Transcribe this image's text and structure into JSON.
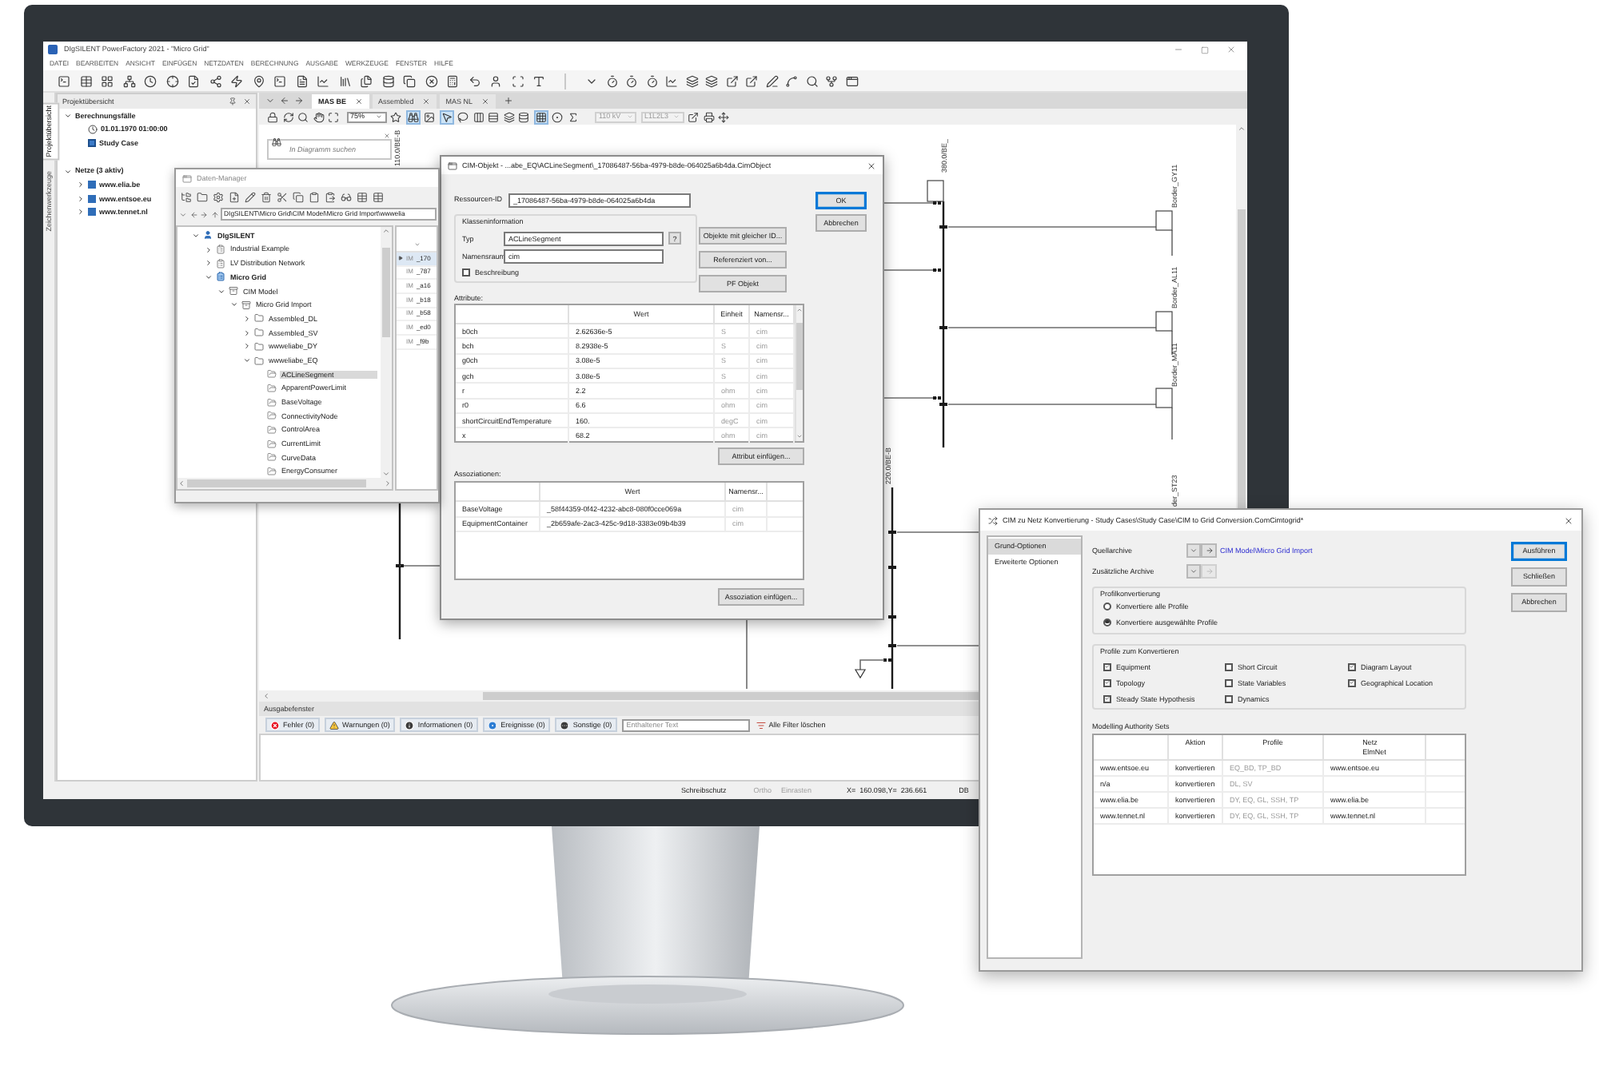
{
  "app": {
    "title": "DIgSILENT PowerFactory 2021 - \"Micro Grid\"",
    "menu": [
      "DATEI",
      "BEARBEITEN",
      "ANSICHT",
      "EINFÜGEN",
      "NETZDATEN",
      "BERECHNUNG",
      "AUSGABE",
      "WERKZEUGE",
      "FENSTER",
      "HILFE"
    ]
  },
  "side_tabs": [
    {
      "label": "Projektübersicht",
      "selected": true
    },
    {
      "label": "Zeichenwerkzeuge",
      "selected": false
    }
  ],
  "project_panel": {
    "title": "Projektübersicht",
    "tree": [
      {
        "label": "Berechnungsfälle",
        "kind": "group",
        "expanded": true,
        "children": [
          {
            "label": "01.01.1970 01:00:00",
            "kind": "time"
          },
          {
            "label": "Study Case",
            "kind": "case"
          }
        ]
      },
      {
        "label": "Netze (3 aktiv)",
        "kind": "group",
        "expanded": true,
        "children": [
          {
            "label": "www.elia.be",
            "kind": "grid",
            "expanded": false
          },
          {
            "label": "www.entsoe.eu",
            "kind": "grid",
            "expanded": false
          },
          {
            "label": "www.tennet.nl",
            "kind": "grid",
            "expanded": false
          }
        ]
      }
    ]
  },
  "diagram": {
    "tabs": [
      {
        "label": "MAS BE",
        "selected": true
      },
      {
        "label": "Assembled",
        "selected": false
      },
      {
        "label": "MAS NL",
        "selected": false
      }
    ],
    "zoom": "75%",
    "voltage": {
      "value": "110 kV",
      "disabled": true
    },
    "phases": {
      "value": "L1L2L3",
      "disabled": true
    },
    "search": {
      "placeholder": "In Diagramm suchen"
    },
    "labels": [
      "110.0/BE-B",
      "380.0/BE_",
      "Border_GY11",
      "Border_AL11",
      "Border_MA11",
      "220.0/BE-B",
      "der_ST23"
    ]
  },
  "data_manager": {
    "title": "Daten-Manager",
    "path": "DIgSILENT\\Micro Grid\\CIM Model\\Micro Grid Import\\wwwelia",
    "tree": [
      {
        "label": "DIgSILENT",
        "kind": "user",
        "expanded": true,
        "selected": false,
        "children": [
          {
            "label": "Industrial Example",
            "kind": "project",
            "expanded": false,
            "selected": false
          },
          {
            "label": "LV Distribution Network",
            "kind": "project",
            "expanded": false,
            "selected": false
          },
          {
            "label": "Micro Grid",
            "kind": "active_project",
            "expanded": true,
            "selected": false,
            "children": [
              {
                "label": "CIM Model",
                "kind": "archive",
                "expanded": true,
                "selected": false,
                "children": [
                  {
                    "label": "Micro Grid Import",
                    "kind": "archive",
                    "expanded": true,
                    "selected": false,
                    "children": [
                      {
                        "label": "Assembled_DL",
                        "kind": "folder",
                        "expanded": false,
                        "selected": false
                      },
                      {
                        "label": "Assembled_SV",
                        "kind": "folder",
                        "expanded": false,
                        "selected": false
                      },
                      {
                        "label": "wwweliabe_DY",
                        "kind": "folder",
                        "expanded": false,
                        "selected": false
                      },
                      {
                        "label": "wwweliabe_EQ",
                        "kind": "folder",
                        "expanded": true,
                        "selected": false,
                        "children": [
                          {
                            "label": "ACLineSegment",
                            "kind": "class",
                            "selected": true
                          },
                          {
                            "label": "ApparentPowerLimit",
                            "kind": "class",
                            "selected": false
                          },
                          {
                            "label": "BaseVoltage",
                            "kind": "class",
                            "selected": false
                          },
                          {
                            "label": "ConnectivityNode",
                            "kind": "class",
                            "selected": false
                          },
                          {
                            "label": "ControlArea",
                            "kind": "class",
                            "selected": false
                          },
                          {
                            "label": "CurrentLimit",
                            "kind": "class",
                            "selected": false
                          },
                          {
                            "label": "CurveData",
                            "kind": "class",
                            "selected": false
                          },
                          {
                            "label": "EnergyConsumer",
                            "kind": "class",
                            "selected": false
                          }
                        ]
                      }
                    ]
                  }
                ]
              }
            ]
          }
        ]
      }
    ],
    "list": [
      {
        "type": "IM",
        "name": "_170",
        "selected": true
      },
      {
        "type": "IM",
        "name": "_787",
        "selected": false
      },
      {
        "type": "IM",
        "name": "_a16",
        "selected": false
      },
      {
        "type": "IM",
        "name": "_b18",
        "selected": false
      },
      {
        "type": "IM",
        "name": "_b58",
        "selected": false
      },
      {
        "type": "IM",
        "name": "_ed0",
        "selected": false
      },
      {
        "type": "IM",
        "name": "_f9b",
        "selected": false
      }
    ]
  },
  "cim_object": {
    "title": "CIM-Objekt - ...abe_EQ\\ACLineSegment\\_17086487-56ba-4979-b8de-064025a6b4da.CimObject",
    "resource_id": {
      "label": "Ressourcen-ID",
      "value": "_17086487-56ba-4979-b8de-064025a6b4da"
    },
    "class_info": {
      "title": "Klasseninformation",
      "type": {
        "label": "Typ",
        "value": "ACLineSegment",
        "help": "?"
      },
      "namespace": {
        "label": "Namensraum",
        "value": "cim"
      },
      "description": {
        "label": "Beschreibung",
        "checked": false
      }
    },
    "side_buttons": [
      "Objekte mit gleicher ID...",
      "Referenziert von...",
      "PF Objekt"
    ],
    "buttons": [
      {
        "label": "OK",
        "default": true
      },
      {
        "label": "Abbrechen",
        "default": false
      }
    ],
    "attributes": {
      "title": "Attribute:",
      "columns": [
        "Wert",
        "Einheit",
        "Namensr..."
      ],
      "rows": [
        {
          "name": "b0ch",
          "value": "2.62636e-5",
          "unit": "S",
          "namespace": "cim"
        },
        {
          "name": "bch",
          "value": "8.2938e-5",
          "unit": "S",
          "namespace": "cim"
        },
        {
          "name": "g0ch",
          "value": "3.08e-5",
          "unit": "S",
          "namespace": "cim"
        },
        {
          "name": "gch",
          "value": "3.08e-5",
          "unit": "S",
          "namespace": "cim"
        },
        {
          "name": "r",
          "value": "2.2",
          "unit": "ohm",
          "namespace": "cim"
        },
        {
          "name": "r0",
          "value": "6.6",
          "unit": "ohm",
          "namespace": "cim"
        },
        {
          "name": "shortCircuitEndTemperature",
          "value": "160.",
          "unit": "degC",
          "namespace": "cim"
        },
        {
          "name": "x",
          "value": "68.2",
          "unit": "ohm",
          "namespace": "cim"
        }
      ],
      "add_button": "Attribut einfügen..."
    },
    "associations": {
      "title": "Assoziationen:",
      "columns": [
        "Wert",
        "Namensr..."
      ],
      "rows": [
        {
          "name": "BaseVoltage",
          "value": "_58f44359-0f42-4232-abc8-080f0cce069a",
          "namespace": "cim"
        },
        {
          "name": "EquipmentContainer",
          "value": "_2b659afe-2ac3-425c-9d18-3383e09b4b39",
          "namespace": "cim"
        }
      ],
      "add_button": "Assoziation einfügen..."
    }
  },
  "output_window": {
    "title": "Ausgabefenster",
    "filters": [
      {
        "label": "Fehler (0)",
        "kind": "error"
      },
      {
        "label": "Warnungen (0)",
        "kind": "warning"
      },
      {
        "label": "Informationen (0)",
        "kind": "info"
      },
      {
        "label": "Ereignisse (0)",
        "kind": "event"
      },
      {
        "label": "Sonstige (0)",
        "kind": "other"
      }
    ],
    "search": {
      "placeholder": "Enthaltener Text"
    },
    "clear_button": "Alle Filter löschen"
  },
  "status_bar": {
    "toggles": [
      {
        "label": "Schreibschutz",
        "active": true
      },
      {
        "label": "Ortho",
        "active": false
      },
      {
        "label": "Einrasten",
        "active": false
      }
    ],
    "coordinates": "X=  160.098,Y=  236.661",
    "database": "DB"
  },
  "conversion_dialog": {
    "title": "CIM zu Netz Konvertierung - Study Cases\\Study Case\\CIM to Grid Conversion.ComCimtogrid*",
    "nav": [
      {
        "label": "Grund-Optionen",
        "selected": true
      },
      {
        "label": "Erweiterte Optionen",
        "selected": false
      }
    ],
    "source": {
      "label": "Quellarchive",
      "link": "CIM Model\\Micro Grid Import",
      "jump_disabled": false
    },
    "additional": {
      "label": "Zusätzliche Archive",
      "jump_disabled": true
    },
    "profile_conversion": {
      "title": "Profilkonvertierung",
      "options": [
        {
          "label": "Konvertiere alle Profile",
          "selected": false
        },
        {
          "label": "Konvertiere ausgewählte Profile",
          "selected": true
        }
      ]
    },
    "profiles": {
      "title": "Profile zum Konvertieren",
      "items": [
        {
          "label": "Equipment",
          "checked": true
        },
        {
          "label": "Short Circuit",
          "checked": false
        },
        {
          "label": "Diagram Layout",
          "checked": true
        },
        {
          "label": "Topology",
          "checked": true
        },
        {
          "label": "State Variables",
          "checked": false
        },
        {
          "label": "Geographical Location",
          "checked": true
        },
        {
          "label": "Steady State Hypothesis",
          "checked": true
        },
        {
          "label": "Dynamics",
          "checked": false
        }
      ]
    },
    "authority_sets": {
      "title": "Modelling Authority Sets",
      "columns": [
        {
          "label": "Aktion"
        },
        {
          "label": "Profile"
        },
        {
          "label": "Netz",
          "sublabel": "ElmNet"
        }
      ],
      "rows": [
        {
          "name": "www.entsoe.eu",
          "action": "konvertieren",
          "profiles": "EQ_BD, TP_BD",
          "grid": "www.entsoe.eu"
        },
        {
          "name": "n/a",
          "action": "konvertieren",
          "profiles": "DL, SV"
        },
        {
          "name": "www.elia.be",
          "action": "konvertieren",
          "profiles": "DY, EQ, GL, SSH, TP",
          "grid": "www.elia.be"
        },
        {
          "name": "www.tennet.nl",
          "action": "konvertieren",
          "profiles": "DY, EQ, GL, SSH, TP",
          "grid": "www.tennet.nl"
        }
      ]
    },
    "buttons": [
      {
        "label": "Ausführen",
        "default": true
      },
      {
        "label": "Schließen",
        "default": false
      },
      {
        "label": "Abbrechen",
        "default": false
      }
    ]
  }
}
